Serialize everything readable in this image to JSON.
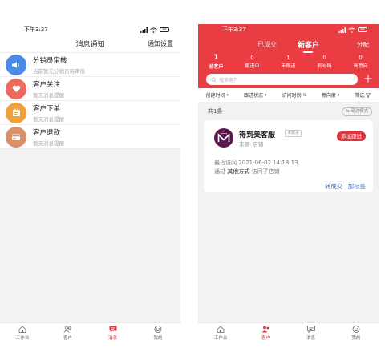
{
  "left": {
    "status_time": "下午3:37",
    "battery": "69",
    "title": "消息通知",
    "settings": "通知设置",
    "messages": [
      {
        "title": "分销员审核",
        "subtitle": "当前暂无分销员待审核",
        "color": "#4a8be8",
        "icon": "speaker-icon"
      },
      {
        "title": "客户关注",
        "subtitle": "暂无消息提醒",
        "color": "#ee6a5d",
        "icon": "heart-icon"
      },
      {
        "title": "客户下单",
        "subtitle": "暂无消息提醒",
        "color": "#f0a13c",
        "icon": "order-icon"
      },
      {
        "title": "客户退款",
        "subtitle": "暂无消息提醒",
        "color": "#d9916a",
        "icon": "refund-icon"
      }
    ],
    "tabs": [
      "工作台",
      "客户",
      "消息",
      "我的"
    ]
  },
  "right": {
    "status_time": "下午3:37",
    "battery": "69",
    "nav_tabs": [
      "已成交",
      "新客户"
    ],
    "distribute": "分配",
    "stats": [
      {
        "n": "1",
        "label": "总客户"
      },
      {
        "n": "0",
        "label": "跟进中"
      },
      {
        "n": "1",
        "label": "未跟进"
      },
      {
        "n": "0",
        "label": "有号码"
      },
      {
        "n": "0",
        "label": "高意向"
      }
    ],
    "search_placeholder": "搜索客户",
    "filters": [
      "创建时间",
      "跟进状态",
      "访问时间",
      "意向度",
      "筛选"
    ],
    "count": "共1条",
    "simple_mode": "简洁模式",
    "customer": {
      "name": "得到美客服",
      "badge": "未跟进",
      "source": "来源: 店铺",
      "add_follow": "添加跟进",
      "last_visit": "最近访问 2021-06-02 14:18:13",
      "via_prefix": "通过 ",
      "via_method": "其他方式",
      "via_suffix": " 访问了店铺",
      "action_convert": "转成交",
      "action_tag": "加标签"
    },
    "tabs": [
      "工作台",
      "客户",
      "消息",
      "我的"
    ]
  },
  "colors": {
    "accent": "#e2323c",
    "header": "#ea3c43",
    "link": "#3a64b8"
  }
}
